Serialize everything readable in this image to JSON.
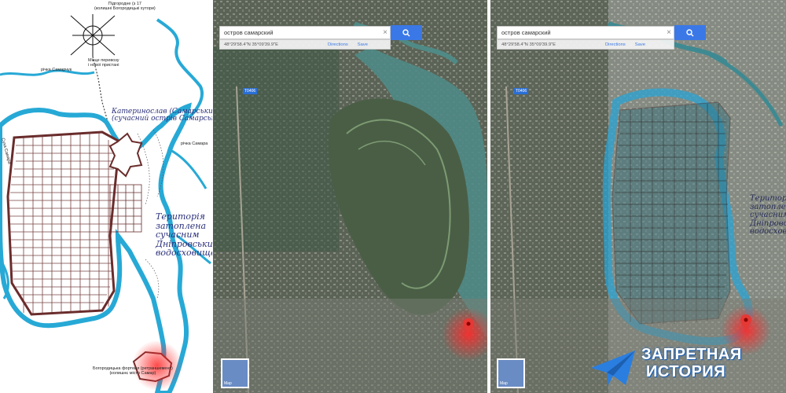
{
  "left_map": {
    "top_label": [
      "Підгородне (з 17",
      "(колишні Богородицькі хутори)"
    ],
    "river_samarchuk": "річка Самарчук",
    "river_samara": "річка Самара",
    "river_sukhaya_samara": "Суха Самара",
    "city_label": [
      "Катеринослав (Самарський)",
      "(сучасний острів Самарський)"
    ],
    "flooded_label": [
      "Територія",
      "затоплена",
      "сучасним",
      "Дніпровським",
      "водосховищем"
    ],
    "fortress_label": [
      "Богородицька фортеця (ретраншемент)",
      "(колишнє місто Самар)"
    ],
    "small_note": [
      "Місце перевозу",
      "і нової пристані"
    ],
    "colors": {
      "water": "#27a9d6",
      "wall": "#6a2c2c",
      "label": "#2a2f7a"
    }
  },
  "middle_map": {
    "search_query": "остров самарский",
    "coords": "48°29'58.4\"N 35°09'39.9\"E",
    "directions": "Directions",
    "save": "Save",
    "thumb_label": "Map",
    "road_badge": "T0406"
  },
  "right_map": {
    "search_query": "остров самарский",
    "coords": "48°29'58.4\"N 35°09'39.9\"E",
    "directions": "Directions",
    "save": "Save",
    "thumb_label": "Map",
    "road_badge": "T0406",
    "overlay_label": [
      "Територія",
      "затоплена",
      "сучасним",
      "Дніпровським",
      "водосховищем"
    ]
  },
  "brand": {
    "line1": "ЗАПРЕТНАЯ",
    "line2": "ИСТОРИЯ",
    "color": "#2a7ee0"
  }
}
